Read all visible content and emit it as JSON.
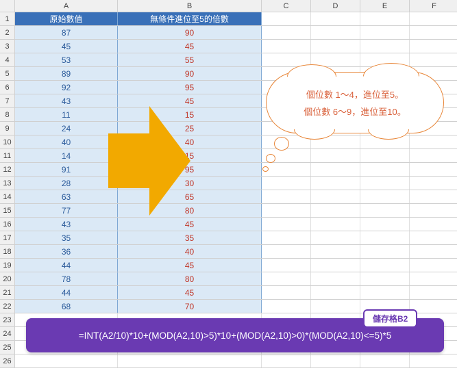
{
  "cols": {
    "A": "A",
    "B": "B",
    "C": "C",
    "D": "D",
    "E": "E",
    "F": "F"
  },
  "headers": {
    "A": "原始數值",
    "B": "無條件進位至5的倍數"
  },
  "rows": [
    {
      "n": "1"
    },
    {
      "n": "2",
      "a": "87",
      "b": "90"
    },
    {
      "n": "3",
      "a": "45",
      "b": "45"
    },
    {
      "n": "4",
      "a": "53",
      "b": "55"
    },
    {
      "n": "5",
      "a": "89",
      "b": "90"
    },
    {
      "n": "6",
      "a": "92",
      "b": "95"
    },
    {
      "n": "7",
      "a": "43",
      "b": "45"
    },
    {
      "n": "8",
      "a": "11",
      "b": "15"
    },
    {
      "n": "9",
      "a": "24",
      "b": "25"
    },
    {
      "n": "10",
      "a": "40",
      "b": "40"
    },
    {
      "n": "11",
      "a": "14",
      "b": "15"
    },
    {
      "n": "12",
      "a": "91",
      "b": "95"
    },
    {
      "n": "13",
      "a": "28",
      "b": "30"
    },
    {
      "n": "14",
      "a": "63",
      "b": "65"
    },
    {
      "n": "15",
      "a": "77",
      "b": "80"
    },
    {
      "n": "16",
      "a": "43",
      "b": "45"
    },
    {
      "n": "17",
      "a": "35",
      "b": "35"
    },
    {
      "n": "18",
      "a": "36",
      "b": "40"
    },
    {
      "n": "19",
      "a": "44",
      "b": "45"
    },
    {
      "n": "20",
      "a": "78",
      "b": "80"
    },
    {
      "n": "21",
      "a": "44",
      "b": "45"
    },
    {
      "n": "22",
      "a": "68",
      "b": "70"
    },
    {
      "n": "23"
    },
    {
      "n": "24"
    },
    {
      "n": "25"
    },
    {
      "n": "26"
    }
  ],
  "cloud": {
    "line1": "個位數 1～4，進位至5。",
    "line2": "個位數 6～9，進位至10。"
  },
  "formula": {
    "label": "儲存格B2",
    "text": "=INT(A2/10)*10+(MOD(A2,10)>5)*10+(MOD(A2,10)>0)*(MOD(A2,10)<=5)*5"
  },
  "chart_data": {
    "type": "table",
    "title": "無條件進位至5的倍數",
    "columns": [
      "原始數值",
      "無條件進位至5的倍數"
    ],
    "data": [
      [
        87,
        90
      ],
      [
        45,
        45
      ],
      [
        53,
        55
      ],
      [
        89,
        90
      ],
      [
        92,
        95
      ],
      [
        43,
        45
      ],
      [
        11,
        15
      ],
      [
        24,
        25
      ],
      [
        40,
        40
      ],
      [
        14,
        15
      ],
      [
        91,
        95
      ],
      [
        28,
        30
      ],
      [
        63,
        65
      ],
      [
        77,
        80
      ],
      [
        43,
        45
      ],
      [
        35,
        35
      ],
      [
        36,
        40
      ],
      [
        44,
        45
      ],
      [
        78,
        80
      ],
      [
        44,
        45
      ],
      [
        68,
        70
      ]
    ],
    "formula": "=INT(A2/10)*10+(MOD(A2,10)>5)*10+(MOD(A2,10)>0)*(MOD(A2,10)<=5)*5",
    "rule": "個位數 1～4 進位至5；個位數 6～9 進位至10"
  }
}
